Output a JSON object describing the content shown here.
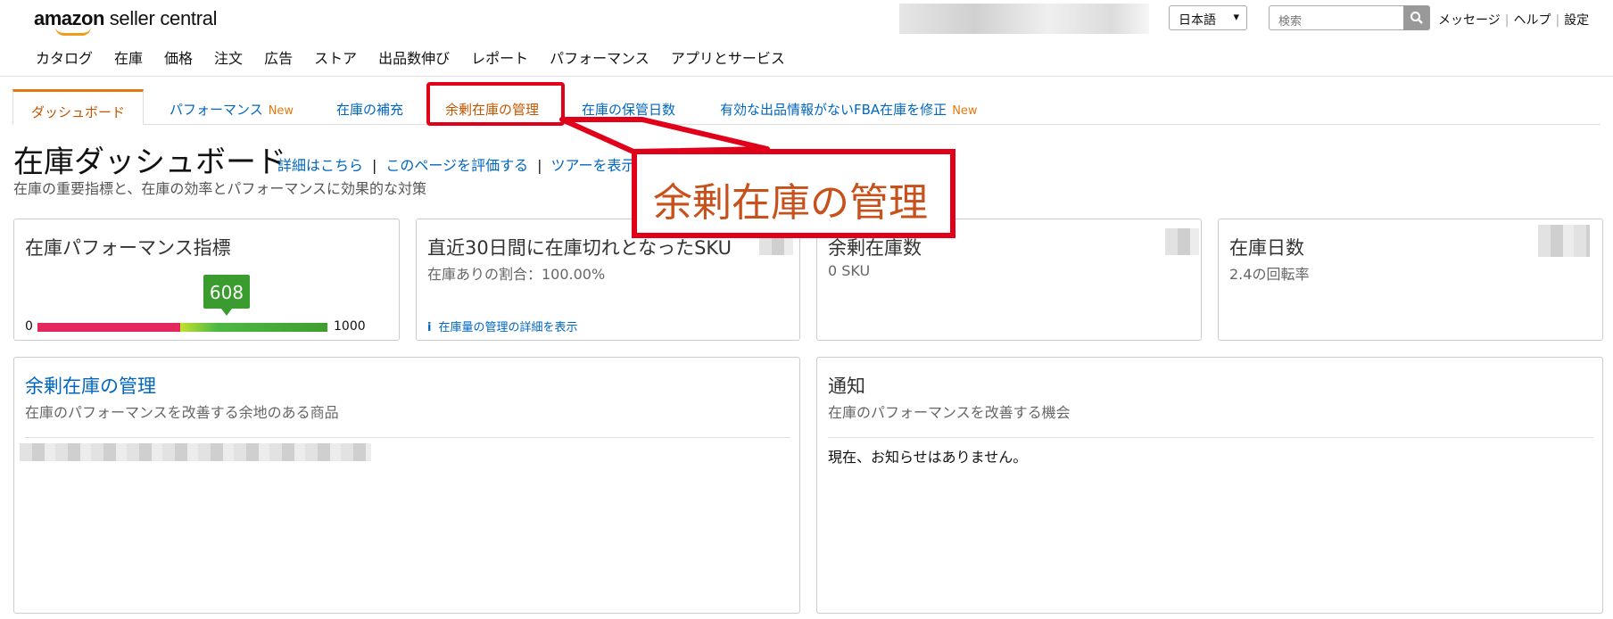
{
  "header": {
    "logo_bold": "amazon",
    "logo_rest": " seller central",
    "language": "日本語",
    "search_placeholder": "検索",
    "links": [
      "メッセージ",
      "ヘルプ",
      "設定"
    ]
  },
  "nav": [
    "カタログ",
    "在庫",
    "価格",
    "注文",
    "広告",
    "ストア",
    "出品数伸び",
    "レポート",
    "パフォーマンス",
    "アプリとサービス"
  ],
  "tabs": [
    {
      "label": "ダッシュボード",
      "badge": ""
    },
    {
      "label": "パフォーマンス",
      "badge": "New"
    },
    {
      "label": "在庫の補充",
      "badge": ""
    },
    {
      "label": "余剰在庫の管理",
      "badge": ""
    },
    {
      "label": "在庫の保管日数",
      "badge": ""
    },
    {
      "label": "有効な出品情報がないFBA在庫を修正",
      "badge": "New"
    }
  ],
  "page": {
    "title": "在庫ダッシュボード",
    "links": [
      "詳細はこちら",
      "このページを評価する",
      "ツアーを表示"
    ],
    "separator": "|",
    "subtitle": "在庫の重要指標と、在庫の効率とパフォーマンスに効果的な対策"
  },
  "callout": {
    "text": "余剰在庫の管理",
    "color": "#e1001a"
  },
  "cards": {
    "ipi": {
      "title": "在庫パフォーマンス指標",
      "value": "608",
      "min": "0",
      "max": "1000",
      "fraction": 0.608
    },
    "stockout": {
      "title": "直近30日間に在庫切れとなったSKU",
      "sub": "在庫ありの割合：100.00%",
      "link_icon": "i",
      "link": "在庫量の管理の詳細を表示"
    },
    "excess": {
      "title": "余剰在庫数",
      "sub": "0 SKU"
    },
    "days": {
      "title": "在庫日数",
      "sub": "2.4の回転率"
    },
    "manage": {
      "title": "余剰在庫の管理",
      "sub": "在庫のパフォーマンスを改善する余地のある商品"
    },
    "notice": {
      "title": "通知",
      "sub": "在庫のパフォーマンスを改善する機会",
      "body": "現在、お知らせはありません。"
    }
  },
  "colors": {
    "accent": "#e47911",
    "link": "#0066c0",
    "gauge_red": "#e4275f",
    "gauge_green": "#3a9b2e"
  }
}
